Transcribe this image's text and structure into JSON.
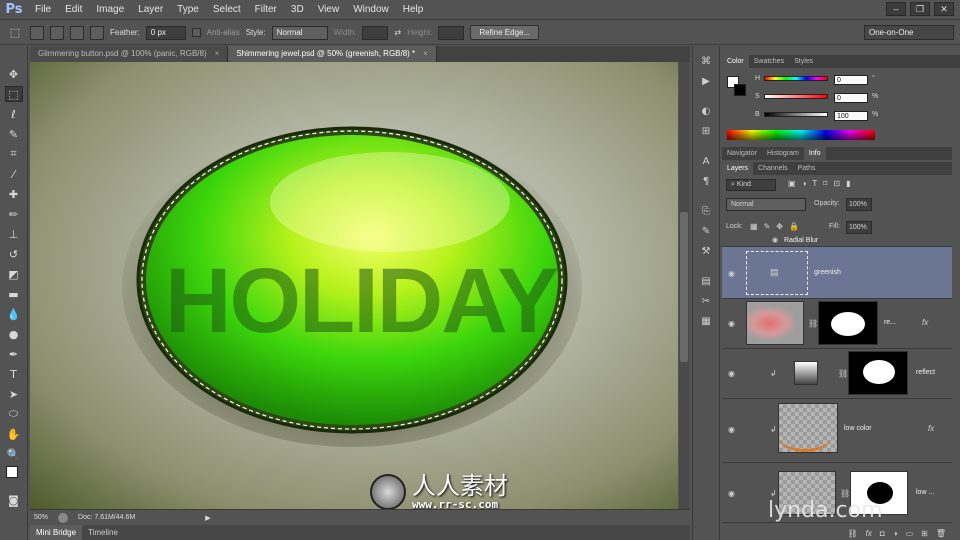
{
  "app": {
    "logo": "Ps"
  },
  "menu": [
    "File",
    "Edit",
    "Image",
    "Layer",
    "Type",
    "Select",
    "Filter",
    "3D",
    "View",
    "Window",
    "Help"
  ],
  "window_controls": [
    "–",
    "❐",
    "✕"
  ],
  "options": {
    "feather_label": "Feather:",
    "feather_value": "0 px",
    "antialias_label": "Anti-alias",
    "style_label": "Style:",
    "style_value": "Normal",
    "width_label": "Width:",
    "height_label": "Height:",
    "refine_button": "Refine Edge...",
    "workspace": "One-on-One"
  },
  "doc_tabs": [
    {
      "label": "Glimmering button.psd @ 100% (panic, RGB/8)",
      "close": "×"
    },
    {
      "label": "Shimmering jewel.psd @ 50% (greenish, RGB/8) *",
      "close": "×"
    }
  ],
  "canvas": {
    "text": "HOLIDAY"
  },
  "status": {
    "zoom": "50%",
    "doc": "Doc: 7.61M/44.6M"
  },
  "bottom_tabs": [
    "Mini Bridge",
    "Timeline"
  ],
  "color_panel": {
    "tabs": [
      "Color",
      "Swatches",
      "Styles"
    ],
    "sliders": [
      {
        "label": "H",
        "value": "0",
        "unit": "°"
      },
      {
        "label": "S",
        "value": "0",
        "unit": "%"
      },
      {
        "label": "B",
        "value": "100",
        "unit": "%"
      }
    ]
  },
  "nav_tabs": [
    "Navigator",
    "Histogram",
    "Info"
  ],
  "layers_panel": {
    "tabs": [
      "Layers",
      "Channels",
      "Paths"
    ],
    "filter_kind": "Kind",
    "blend_mode": "Normal",
    "opacity_label": "Opacity:",
    "opacity_value": "100%",
    "lock_label": "Lock:",
    "fill_label": "Fill:",
    "fill_value": "100%",
    "layers": [
      {
        "name": "Radial Blur"
      },
      {
        "name": "greenish"
      },
      {
        "name": "re..."
      },
      {
        "name": "reflect"
      },
      {
        "name": "low color"
      },
      {
        "name": "low ..."
      }
    ]
  },
  "watermark": {
    "brand": "人人素材",
    "url": "www.rr-sc.com",
    "lynda": "lynda.com"
  }
}
